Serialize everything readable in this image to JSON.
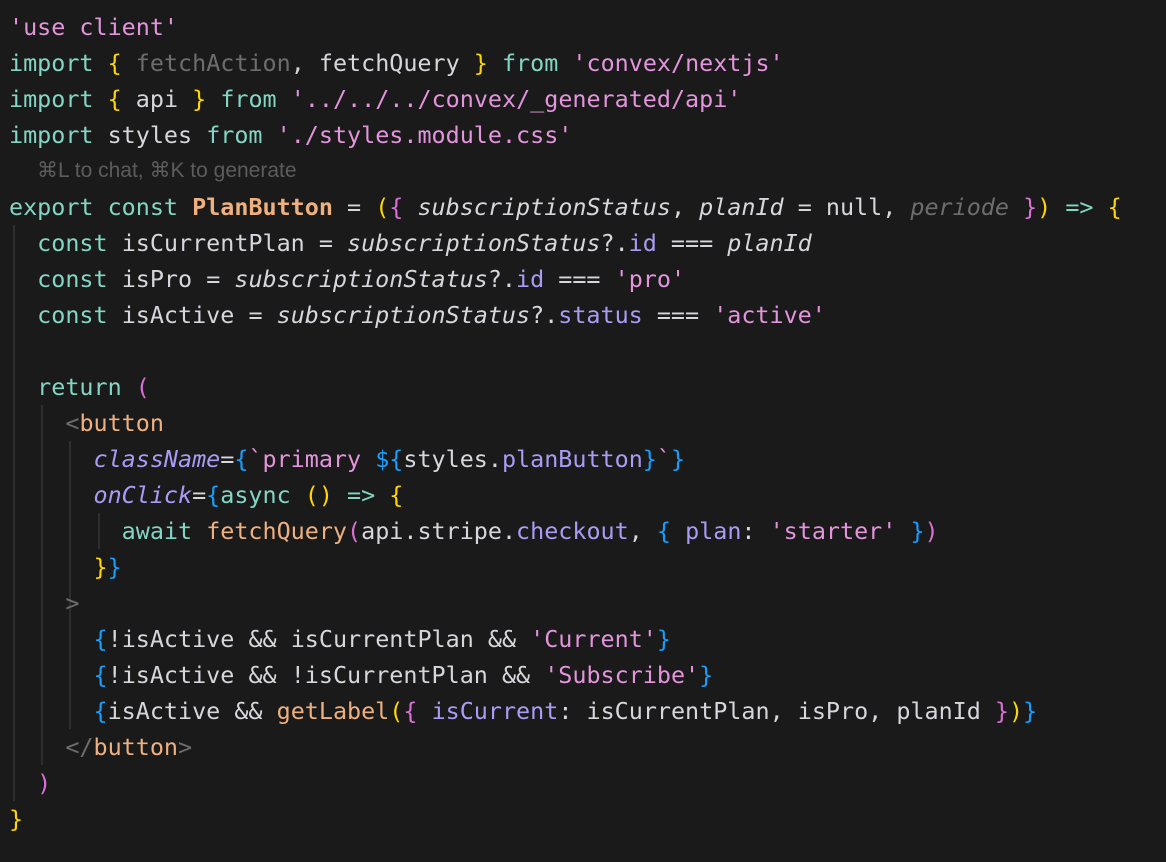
{
  "colors": {
    "background": "#1a1a1a",
    "default": "#d6d6dd",
    "keyword": "#83d6c5",
    "string": "#e394dc",
    "variable": "#d6d6dd",
    "property": "#aa9bf5",
    "function": "#efb080",
    "tag": "#87c3ff",
    "brace_yellow": "#ffd700",
    "brace_pink": "#da70d6",
    "brace_blue": "#179fff",
    "comment": "#6d6d6d",
    "hint": "#5c5c5c",
    "punctuation": "#d6d6dd"
  },
  "hint_text": "⌘L to chat, ⌘K to generate",
  "lines": [
    [
      [
        "'use client'",
        "string"
      ]
    ],
    [
      [
        "import",
        "keyword"
      ],
      [
        " ",
        ""
      ],
      [
        "{",
        "brace_yellow"
      ],
      [
        " ",
        ""
      ],
      [
        "fetchAction",
        "comment"
      ],
      [
        ", ",
        "default"
      ],
      [
        "fetchQuery",
        "variable"
      ],
      [
        " ",
        ""
      ],
      [
        "}",
        "brace_yellow"
      ],
      [
        " ",
        ""
      ],
      [
        "from",
        "keyword"
      ],
      [
        " ",
        ""
      ],
      [
        "'convex/nextjs'",
        "string"
      ]
    ],
    [
      [
        "import",
        "keyword"
      ],
      [
        " ",
        ""
      ],
      [
        "{",
        "brace_yellow"
      ],
      [
        " ",
        ""
      ],
      [
        "api",
        "variable"
      ],
      [
        " ",
        ""
      ],
      [
        "}",
        "brace_yellow"
      ],
      [
        " ",
        ""
      ],
      [
        "from",
        "keyword"
      ],
      [
        " ",
        ""
      ],
      [
        "'../../../convex/_generated/api'",
        "string"
      ]
    ],
    [
      [
        "import",
        "keyword"
      ],
      [
        " ",
        ""
      ],
      [
        "styles",
        "variable"
      ],
      [
        " ",
        ""
      ],
      [
        "from",
        "keyword"
      ],
      [
        " ",
        ""
      ],
      [
        "'./styles.module.css'",
        "string"
      ]
    ],
    "HINT",
    [
      [
        "export",
        "keyword"
      ],
      [
        " ",
        ""
      ],
      [
        "const",
        "keyword"
      ],
      [
        " ",
        ""
      ],
      [
        "PlanButton",
        "function",
        "b"
      ],
      [
        " = ",
        "default"
      ],
      [
        "(",
        "brace_yellow"
      ],
      [
        "{",
        "brace_pink"
      ],
      [
        " ",
        ""
      ],
      [
        "subscriptionStatus",
        "variable",
        "i"
      ],
      [
        ", ",
        "default"
      ],
      [
        "planId",
        "variable",
        "i"
      ],
      [
        " = ",
        "default"
      ],
      [
        "null",
        "default"
      ],
      [
        ", ",
        "default"
      ],
      [
        "periode",
        "comment",
        "i"
      ],
      [
        " ",
        ""
      ],
      [
        "}",
        "brace_pink"
      ],
      [
        ")",
        "brace_yellow"
      ],
      [
        " => ",
        "keyword"
      ],
      [
        "{",
        "brace_yellow"
      ]
    ],
    [
      [
        "  ",
        ""
      ],
      [
        "const",
        "keyword"
      ],
      [
        " ",
        ""
      ],
      [
        "isCurrentPlan",
        "variable"
      ],
      [
        " = ",
        "default"
      ],
      [
        "subscriptionStatus",
        "variable",
        "i"
      ],
      [
        "?.",
        "default"
      ],
      [
        "id",
        "property"
      ],
      [
        " === ",
        "default"
      ],
      [
        "planId",
        "variable",
        "i"
      ]
    ],
    [
      [
        "  ",
        ""
      ],
      [
        "const",
        "keyword"
      ],
      [
        " ",
        ""
      ],
      [
        "isPro",
        "variable"
      ],
      [
        " = ",
        "default"
      ],
      [
        "subscriptionStatus",
        "variable",
        "i"
      ],
      [
        "?.",
        "default"
      ],
      [
        "id",
        "property"
      ],
      [
        " === ",
        "default"
      ],
      [
        "'pro'",
        "string"
      ]
    ],
    [
      [
        "  ",
        ""
      ],
      [
        "const",
        "keyword"
      ],
      [
        " ",
        ""
      ],
      [
        "isActive",
        "variable"
      ],
      [
        " = ",
        "default"
      ],
      [
        "subscriptionStatus",
        "variable",
        "i"
      ],
      [
        "?.",
        "default"
      ],
      [
        "status",
        "property"
      ],
      [
        " === ",
        "default"
      ],
      [
        "'active'",
        "string"
      ]
    ],
    [],
    [
      [
        "  ",
        ""
      ],
      [
        "return",
        "keyword"
      ],
      [
        " ",
        ""
      ],
      [
        "(",
        "brace_pink"
      ]
    ],
    [
      [
        "    ",
        ""
      ],
      [
        "<",
        "comment"
      ],
      [
        "button",
        "function"
      ]
    ],
    [
      [
        "      ",
        ""
      ],
      [
        "className",
        "property",
        "i"
      ],
      [
        "=",
        "default"
      ],
      [
        "{",
        "brace_blue"
      ],
      [
        "`primary ",
        "string"
      ],
      [
        "${",
        "brace_blue"
      ],
      [
        "styles",
        "variable"
      ],
      [
        ".",
        "default"
      ],
      [
        "planButton",
        "property"
      ],
      [
        "}",
        "brace_blue"
      ],
      [
        "`",
        "string"
      ],
      [
        "}",
        "brace_blue"
      ]
    ],
    [
      [
        "      ",
        ""
      ],
      [
        "onClick",
        "property",
        "i"
      ],
      [
        "=",
        "default"
      ],
      [
        "{",
        "brace_blue"
      ],
      [
        "async",
        "keyword"
      ],
      [
        " ",
        ""
      ],
      [
        "()",
        "brace_yellow"
      ],
      [
        " => ",
        "keyword"
      ],
      [
        "{",
        "brace_yellow"
      ]
    ],
    [
      [
        "        ",
        ""
      ],
      [
        "await",
        "keyword"
      ],
      [
        " ",
        ""
      ],
      [
        "fetchQuery",
        "function"
      ],
      [
        "(",
        "brace_pink"
      ],
      [
        "api",
        "variable"
      ],
      [
        ".",
        "default"
      ],
      [
        "stripe",
        "variable"
      ],
      [
        ".",
        "default"
      ],
      [
        "checkout",
        "property"
      ],
      [
        ", ",
        "default"
      ],
      [
        "{",
        "brace_blue"
      ],
      [
        " ",
        ""
      ],
      [
        "plan",
        "property"
      ],
      [
        ": ",
        "default"
      ],
      [
        "'starter'",
        "string"
      ],
      [
        " ",
        ""
      ],
      [
        "}",
        "brace_blue"
      ],
      [
        ")",
        "brace_pink"
      ]
    ],
    [
      [
        "      ",
        ""
      ],
      [
        "}",
        "brace_yellow"
      ],
      [
        "}",
        "brace_blue"
      ]
    ],
    [
      [
        "    ",
        ""
      ],
      [
        ">",
        "comment"
      ]
    ],
    [
      [
        "      ",
        ""
      ],
      [
        "{",
        "brace_blue"
      ],
      [
        "!",
        "default"
      ],
      [
        "isActive",
        "variable"
      ],
      [
        " && ",
        "default"
      ],
      [
        "isCurrentPlan",
        "variable"
      ],
      [
        " && ",
        "default"
      ],
      [
        "'Current'",
        "string"
      ],
      [
        "}",
        "brace_blue"
      ]
    ],
    [
      [
        "      ",
        ""
      ],
      [
        "{",
        "brace_blue"
      ],
      [
        "!",
        "default"
      ],
      [
        "isActive",
        "variable"
      ],
      [
        " && ",
        "default"
      ],
      [
        "!",
        "default"
      ],
      [
        "isCurrentPlan",
        "variable"
      ],
      [
        " && ",
        "default"
      ],
      [
        "'Subscribe'",
        "string"
      ],
      [
        "}",
        "brace_blue"
      ]
    ],
    [
      [
        "      ",
        ""
      ],
      [
        "{",
        "brace_blue"
      ],
      [
        "isActive",
        "variable"
      ],
      [
        " && ",
        "default"
      ],
      [
        "getLabel",
        "function"
      ],
      [
        "(",
        "brace_yellow"
      ],
      [
        "{",
        "brace_pink"
      ],
      [
        " ",
        ""
      ],
      [
        "isCurrent",
        "property"
      ],
      [
        ": ",
        "default"
      ],
      [
        "isCurrentPlan",
        "variable"
      ],
      [
        ", ",
        "default"
      ],
      [
        "isPro",
        "variable"
      ],
      [
        ", ",
        "default"
      ],
      [
        "planId",
        "variable"
      ],
      [
        " ",
        ""
      ],
      [
        "}",
        "brace_pink"
      ],
      [
        ")",
        "brace_yellow"
      ],
      [
        "}",
        "brace_blue"
      ]
    ],
    [
      [
        "    ",
        ""
      ],
      [
        "</",
        "comment"
      ],
      [
        "button",
        "function"
      ],
      [
        ">",
        "comment"
      ]
    ],
    [
      [
        "  ",
        ""
      ],
      [
        ")",
        "brace_pink"
      ]
    ],
    [
      [
        "}",
        "brace_yellow"
      ]
    ]
  ]
}
